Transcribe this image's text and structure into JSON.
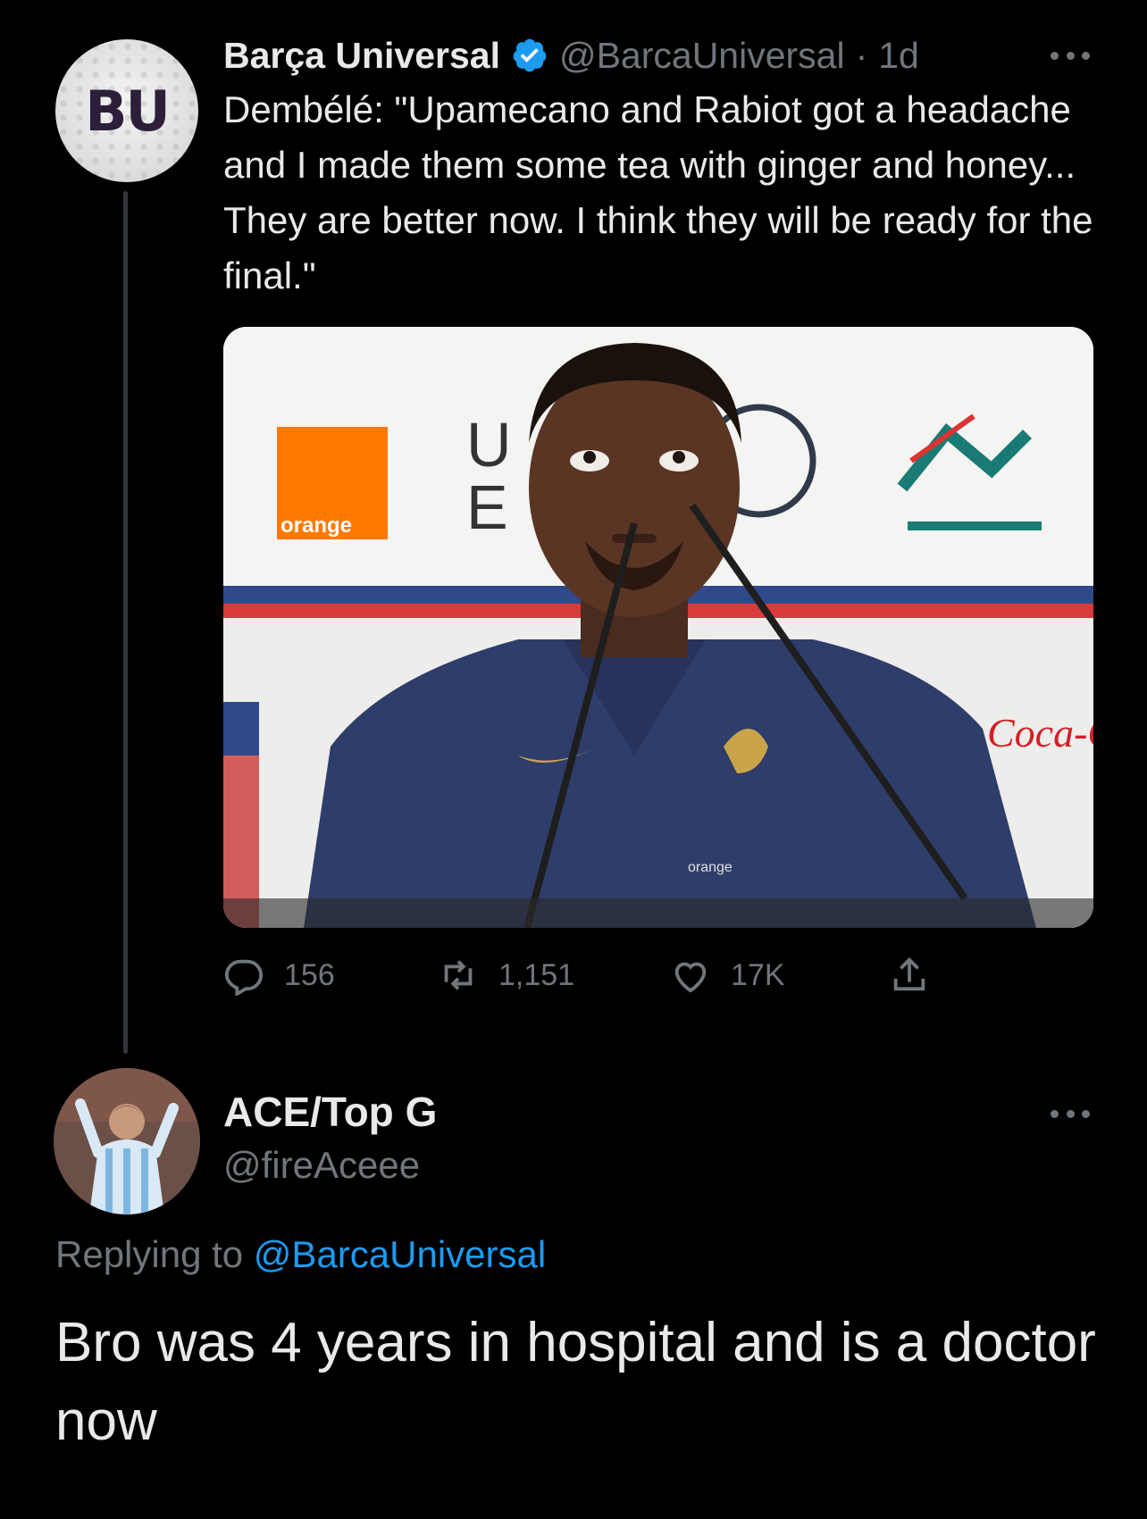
{
  "original_tweet": {
    "avatar_text": "BU",
    "display_name": "Barça Universal",
    "handle": "@BarcaUniversal",
    "separator": "·",
    "time": "1d",
    "text": "Dembélé: \"Upamecano and Rabiot got a headache and I made them some tea with ginger and honey... They are better now. I think they will be ready for the final.\"",
    "media": {
      "sponsor_orange": "orange",
      "board_text_1": "U",
      "board_text_2": "E",
      "sponsor_coca": "Coca-C",
      "shirt_orange": "orange"
    },
    "actions": {
      "replies": "156",
      "retweets": "1,151",
      "likes": "17K"
    }
  },
  "reply": {
    "display_name": "ACE/Top G",
    "handle": "@fireAceee",
    "replying_prefix": "Replying to ",
    "replying_to": "@BarcaUniversal",
    "text": "Bro was 4 years in hospital and is a doctor now"
  },
  "colors": {
    "background": "#000000",
    "text_primary": "#e7e9ea",
    "text_secondary": "#71767b",
    "accent_blue": "#1d9bf0",
    "thread_line": "#333639"
  },
  "icons": [
    "verified-badge-icon",
    "more-icon",
    "reply-icon",
    "retweet-icon",
    "like-icon",
    "share-icon"
  ]
}
